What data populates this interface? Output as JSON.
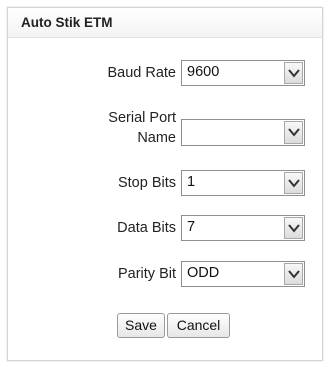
{
  "panel": {
    "title": "Auto Stik ETM"
  },
  "fields": [
    {
      "label": "Baud Rate",
      "value": "9600"
    },
    {
      "label_line1": "Serial Port",
      "label_line2": "Name",
      "value": ""
    },
    {
      "label": "Stop Bits",
      "value": "1"
    },
    {
      "label": "Data Bits",
      "value": "7"
    },
    {
      "label": "Parity Bit",
      "value": "ODD"
    }
  ],
  "buttons": {
    "save_label": "Save",
    "cancel_label": "Cancel"
  }
}
